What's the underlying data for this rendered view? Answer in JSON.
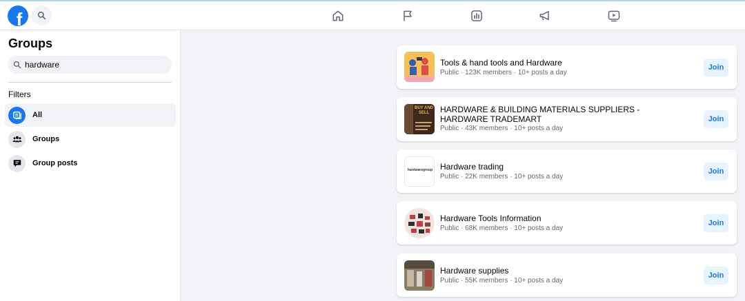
{
  "header": {
    "logo_letter": "f"
  },
  "sidebar": {
    "title": "Groups",
    "search": {
      "value": "hardware"
    },
    "filters_label": "Filters",
    "items": [
      {
        "label": "All",
        "icon": "feed-icon",
        "active": true
      },
      {
        "label": "Groups",
        "icon": "people-icon",
        "active": false
      },
      {
        "label": "Group posts",
        "icon": "post-bubble-icon",
        "active": false
      }
    ]
  },
  "results": [
    {
      "title": "Tools & hand tools and Hardware",
      "meta": "Public · 123K members · 10+ posts a day",
      "join": "Join"
    },
    {
      "title": "HARDWARE & BUILDING MATERIALS SUPPLIERS - HARDWARE TRADEMART",
      "meta": "Public · 43K members · 10+ posts a day",
      "join": "Join",
      "thumb_text": "BUY AND SELL"
    },
    {
      "title": "Hardware trading",
      "meta": "Public · 22K members · 10+ posts a day",
      "join": "Join",
      "thumb_text": "hardwaregroup"
    },
    {
      "title": "Hardware Tools Information",
      "meta": "Public · 68K members · 10+ posts a day",
      "join": "Join"
    },
    {
      "title": "Hardware supplies",
      "meta": "Public · 55K members · 10+ posts a day",
      "join": "Join"
    }
  ],
  "colors": {
    "accent": "#1877f2",
    "join_bg": "#e7f3ff",
    "page_bg": "#f0f2f5",
    "meta": "#65676b"
  }
}
